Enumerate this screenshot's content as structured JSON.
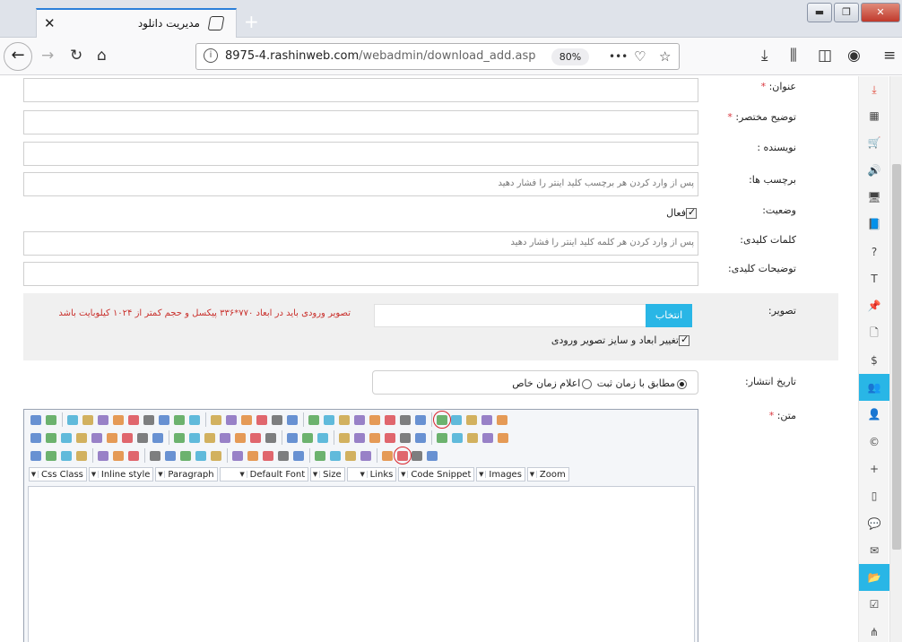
{
  "browser": {
    "tab_title": "مدیریت دانلود",
    "tab_close": "✕",
    "new_tab": "+",
    "url_host": "8975-4.rashinweb.com",
    "url_path": "/webadmin/download_add.asp",
    "zoom": "80%",
    "more": "•••",
    "window_minimize": "▬",
    "window_restore": "❐",
    "window_close": "✕"
  },
  "sidebar": {
    "items": [
      {
        "icon": "download-icon",
        "glyph": "⤓",
        "active": false,
        "red": true
      },
      {
        "icon": "film-icon",
        "glyph": "▦",
        "active": false
      },
      {
        "icon": "cart-icon",
        "glyph": "🛒",
        "active": false
      },
      {
        "icon": "volume-icon",
        "glyph": "🔊",
        "active": false
      },
      {
        "icon": "monitor-icon",
        "glyph": "🖥",
        "active": false
      },
      {
        "icon": "book-icon",
        "glyph": "📘",
        "active": false
      },
      {
        "icon": "question-icon",
        "glyph": "?",
        "active": false
      },
      {
        "icon": "text-icon",
        "glyph": "T",
        "active": false
      },
      {
        "icon": "pin-icon",
        "glyph": "📌",
        "active": false
      },
      {
        "icon": "file-icon",
        "glyph": "🗋",
        "active": false
      },
      {
        "icon": "file-dollar-icon",
        "glyph": "$",
        "active": false
      },
      {
        "icon": "users-icon",
        "glyph": "👥",
        "active": true
      },
      {
        "icon": "user-icon",
        "glyph": "👤",
        "active": false
      },
      {
        "icon": "copyright-icon",
        "glyph": "©",
        "active": false
      },
      {
        "icon": "user-plus-icon",
        "glyph": "+",
        "active": false
      },
      {
        "icon": "mobile-icon",
        "glyph": "▯",
        "active": false
      },
      {
        "icon": "comments-icon",
        "glyph": "💬",
        "active": false
      },
      {
        "icon": "envelope-icon",
        "glyph": "✉",
        "active": false
      },
      {
        "icon": "folder-open-icon",
        "glyph": "📂",
        "active": true
      },
      {
        "icon": "checkbox-icon",
        "glyph": "☑",
        "active": false
      },
      {
        "icon": "sitemap-icon",
        "glyph": "⋔",
        "active": false
      }
    ]
  },
  "form": {
    "title_label": "عنوان:",
    "summary_label": "توضیح مختصر:",
    "author_label": "نویسنده :",
    "tags_label": "برچسب ها:",
    "tags_placeholder": "پس از وارد کردن هر برچسب کلید اینتر را فشار دهید",
    "status_label": "وضعیت:",
    "active_label": "فعال",
    "keywords_label": "کلمات کلیدی:",
    "keywords_placeholder": "پس از وارد کردن هر کلمه کلید اینتر را فشار دهید",
    "keyword_desc_label": "توضیحات کلیدی:",
    "image_label": "تصویر:",
    "pick_button": "انتخاب",
    "image_warning": "تصویر ورودی باید در ابعاد ۷۷۰*۳۳۶ پیکسل و حجم کمتر از ۱۰۲۴ کیلوبایت باشد",
    "resize_label": "تغییر ابعاد و سایز تصویر ورودی",
    "publish_label": "تاریخ انتشار:",
    "publish_option_1": "مطابق با زمان ثبت",
    "publish_option_2": "اعلام زمان خاص",
    "text_label": "متن:",
    "required_mark": "*"
  },
  "editor": {
    "dropdowns": [
      "Css Class",
      "Inline style",
      "Paragraph",
      "Default Font",
      "Size",
      "Links",
      "Code Snippet",
      "Images",
      "Zoom"
    ],
    "colors": [
      "#3a6fc4",
      "#c79a2b",
      "#d9363e",
      "#3f9b3f",
      "#7a59b5",
      "#555555",
      "#2fa6d0",
      "#e07b1f"
    ]
  }
}
